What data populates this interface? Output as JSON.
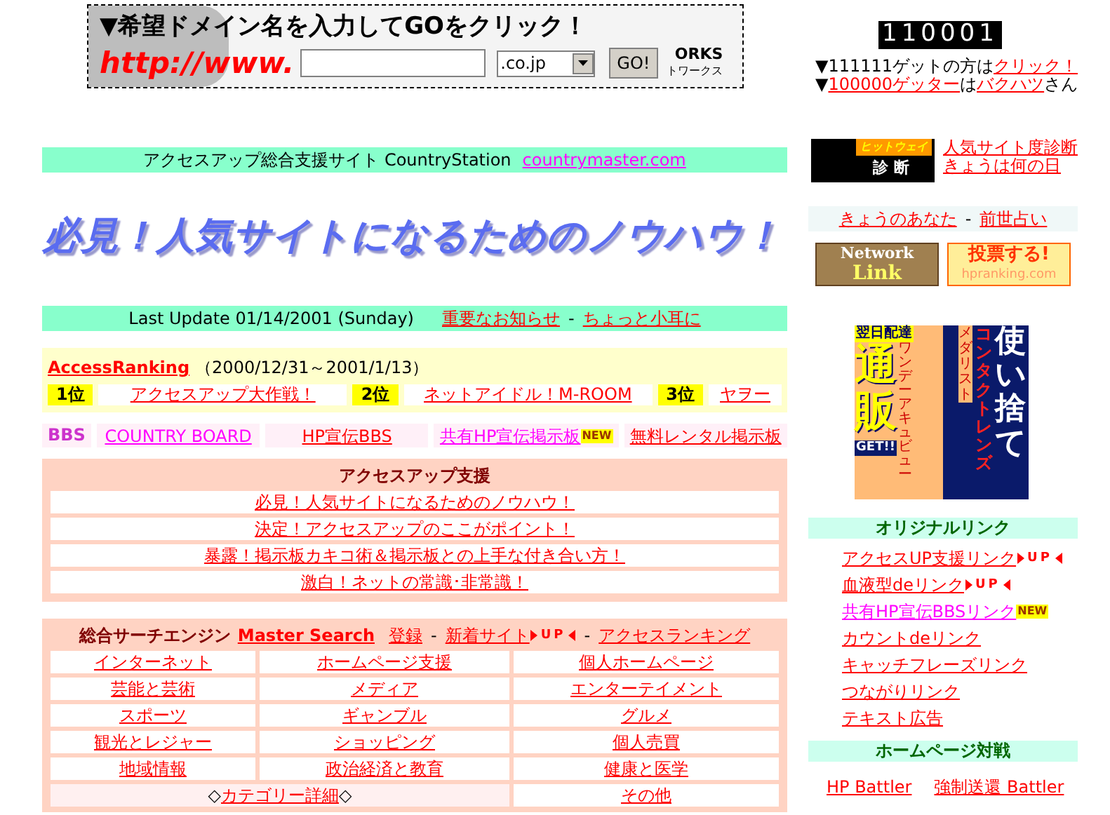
{
  "domain_banner": {
    "title": "▼希望ドメイン名を入力してGOをクリック！",
    "prefix": "http://www.",
    "tld": ".co.jp",
    "go_button": "GO!",
    "logo_text": "ORKS",
    "logo_subtext": "トワークス"
  },
  "counter": {
    "value": "110001",
    "lines": [
      [
        {
          "text": "▼111111ゲットの方は",
          "link": false
        },
        {
          "text": "クリック！",
          "link": true
        }
      ],
      [
        {
          "text": "▼",
          "link": false
        },
        {
          "text": "100000ゲッター",
          "link": true
        },
        {
          "text": "は",
          "link": false
        },
        {
          "text": "バクハツ",
          "link": true
        },
        {
          "text": "さん",
          "link": false
        }
      ]
    ]
  },
  "site_bar": {
    "text": "アクセスアップ総合支援サイト CountryStation",
    "link": {
      "text": "countrymaster.com",
      "visited": true
    }
  },
  "headline": "必見！人気サイトになるためのノウハウ！",
  "update_bar": {
    "text": "Last Update 01/14/2001 (Sunday)",
    "items": [
      {
        "kind": "link",
        "text": "重要なお知らせ",
        "visited": false
      },
      {
        "kind": "sep",
        "text": "-"
      },
      {
        "kind": "link",
        "text": "ちょっと小耳に",
        "visited": false
      }
    ]
  },
  "ranking": {
    "title": "AccessRanking",
    "period": "（2000/12/31～2001/1/13）",
    "entries": [
      {
        "rank": "1位",
        "site": "アクセスアップ大作戦！"
      },
      {
        "rank": "2位",
        "site": "ネットアイドル！M-ROOM"
      },
      {
        "rank": "3位",
        "site": "ヤヲー"
      }
    ]
  },
  "bbs": {
    "label": "BBS",
    "links": [
      {
        "text": "COUNTRY BOARD",
        "visited": true
      },
      {
        "text": "HP宣伝BBS",
        "visited": false
      },
      {
        "text": "共有HP宣伝掲示板",
        "visited": true,
        "badge": {
          "kind": "new",
          "text": "NEW"
        }
      },
      {
        "text": "無料レンタル掲示板",
        "visited": false
      }
    ]
  },
  "support": {
    "title": "アクセスアップ支援",
    "links": [
      "必見！人気サイトになるためのノウハウ！",
      "決定！アクセスアップのここがポイント！",
      "暴露！掲示板カキコ術＆掲示板との上手な付き合い方！",
      "激白！ネットの常識･非常識！"
    ]
  },
  "search": {
    "title": "総合サーチエンジン",
    "name_link": "Master Search",
    "items": [
      {
        "kind": "link",
        "text": "登録"
      },
      {
        "kind": "sep",
        "text": "-"
      },
      {
        "kind": "link",
        "text": "新着サイト",
        "badge": {
          "kind": "up",
          "text": "UP"
        }
      },
      {
        "kind": "sep",
        "text": "-"
      },
      {
        "kind": "link",
        "text": "アクセスランキング"
      }
    ],
    "categories": [
      [
        "インターネット",
        "ホームページ支援",
        "個人ホームページ"
      ],
      [
        "芸能と芸術",
        "メディア",
        "エンターテイメント"
      ],
      [
        "スポーツ",
        "ギャンブル",
        "グルメ"
      ],
      [
        "観光とレジャー",
        "ショッピング",
        "個人売買"
      ],
      [
        "地域情報",
        "政治経済と教育",
        "健康と医学"
      ]
    ],
    "detail": {
      "mark_left": "◇",
      "link": "カテゴリー詳細",
      "mark_right": "◇"
    },
    "other": "その他"
  },
  "diagnosis": {
    "logo_title": "ヒットウェイ",
    "logo_label": "診断",
    "links": [
      "人気サイト度診断",
      "きょうは何の日"
    ]
  },
  "fortune": {
    "items": [
      {
        "kind": "link",
        "text": "きょうのあなた"
      },
      {
        "kind": "sep",
        "text": "-"
      },
      {
        "kind": "link",
        "text": "前世占い"
      }
    ]
  },
  "network_link": {
    "line1": "Network",
    "line2": "Link"
  },
  "vote_button": {
    "label": "投票する!",
    "site": "hpranking.com"
  },
  "ad": {
    "tag": "翌日配達",
    "big": "通販",
    "product": "ワンデーアキュビュー",
    "product2": "メダリスト",
    "headline": "使い捨て",
    "subject": "コンタクトレンズ",
    "cta": "GET!!"
  },
  "original_links": {
    "title": "オリジナルリンク",
    "links": [
      {
        "text": "アクセスUP支援リンク",
        "visited": false,
        "badge": {
          "kind": "up",
          "text": "UP"
        }
      },
      {
        "text": "血液型deリンク",
        "visited": false,
        "badge": {
          "kind": "up",
          "text": "UP"
        }
      },
      {
        "text": "共有HP宣伝BBSリンク",
        "visited": true,
        "badge": {
          "kind": "new",
          "text": "NEW"
        }
      },
      {
        "text": "カウントdeリンク",
        "visited": false
      },
      {
        "text": "キャッチフレーズリンク",
        "visited": false
      },
      {
        "text": "つながりリンク",
        "visited": false
      },
      {
        "text": "テキスト広告",
        "visited": false
      }
    ]
  },
  "battle": {
    "title": "ホームページ対戦",
    "links": [
      "HP Battler",
      "強制送還 Battler"
    ]
  }
}
